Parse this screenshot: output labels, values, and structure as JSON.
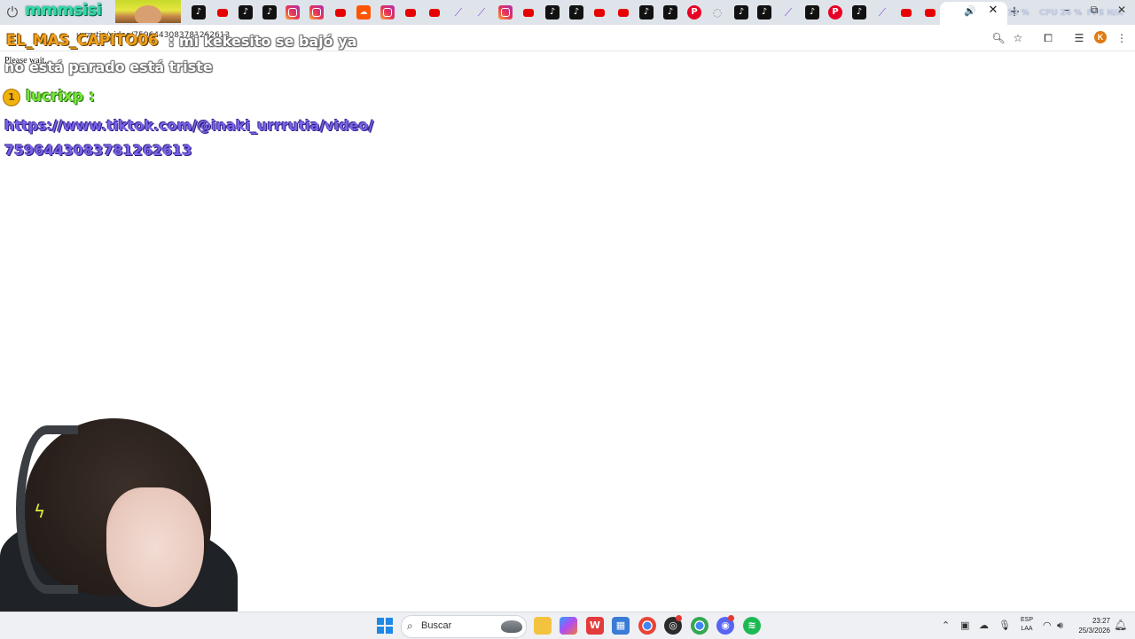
{
  "browser": {
    "channel_name": "mmmsisi",
    "tab_strip_icons": [
      "tiktok",
      "youtube",
      "tiktok",
      "tiktok",
      "instagram",
      "instagram",
      "youtube",
      "soundcloud",
      "instagram",
      "youtube",
      "youtube",
      "feather",
      "feather",
      "instagram",
      "youtube",
      "tiktok",
      "tiktok",
      "youtube",
      "youtube",
      "tiktok",
      "tiktok",
      "pinterest",
      "globe",
      "tiktok",
      "tiktok",
      "feather",
      "tiktok",
      "pinterest",
      "tiktok",
      "feather",
      "youtube",
      "youtube"
    ],
    "active_tab_close": "✕",
    "new_tab": "+",
    "hud_left": "13 %",
    "hud_cpu": "CPU 24 %",
    "hud_right": "FPS N/A",
    "url_overlay": "urrrutia/video/7596443083781262613",
    "toolbar_icons": [
      "zoom-icon",
      "bookmark-star-icon",
      "extensions-icon",
      "media-queue-icon"
    ],
    "profile_initial": "K"
  },
  "page": {
    "status_text": "Please wait..."
  },
  "chat": {
    "messages": [
      {
        "user": "EL_MAS_CAPITO06",
        "separator": " : ",
        "text_line1": "mi kekesito se bajó ya",
        "text_line2": "no está parado está triste",
        "user_color": "#f0a01e"
      },
      {
        "badge": "1",
        "user": "lucrixp",
        "separator": " :",
        "text": "https://www.tiktok.com/@inaki_urrrutia/video/7596443083781262613",
        "user_color": "#74e83a",
        "text_color": "#7b62e6"
      }
    ]
  },
  "taskbar": {
    "search_label": "Buscar",
    "apps": [
      "file-explorer",
      "copilot",
      "wps-office",
      "microsoft-store",
      "chrome",
      "obs-studio",
      "chrome-active",
      "discord",
      "spotify"
    ],
    "language_top": "ESP",
    "language_bottom": "LAA",
    "time": "23:27",
    "date": "25/3/2026"
  },
  "colors": {
    "tabstrip_bg": "#dfe3ea",
    "page_bg": "#ffffff",
    "taskbar_bg": "#eef0f3",
    "accent_blue": "#1e88e5"
  }
}
